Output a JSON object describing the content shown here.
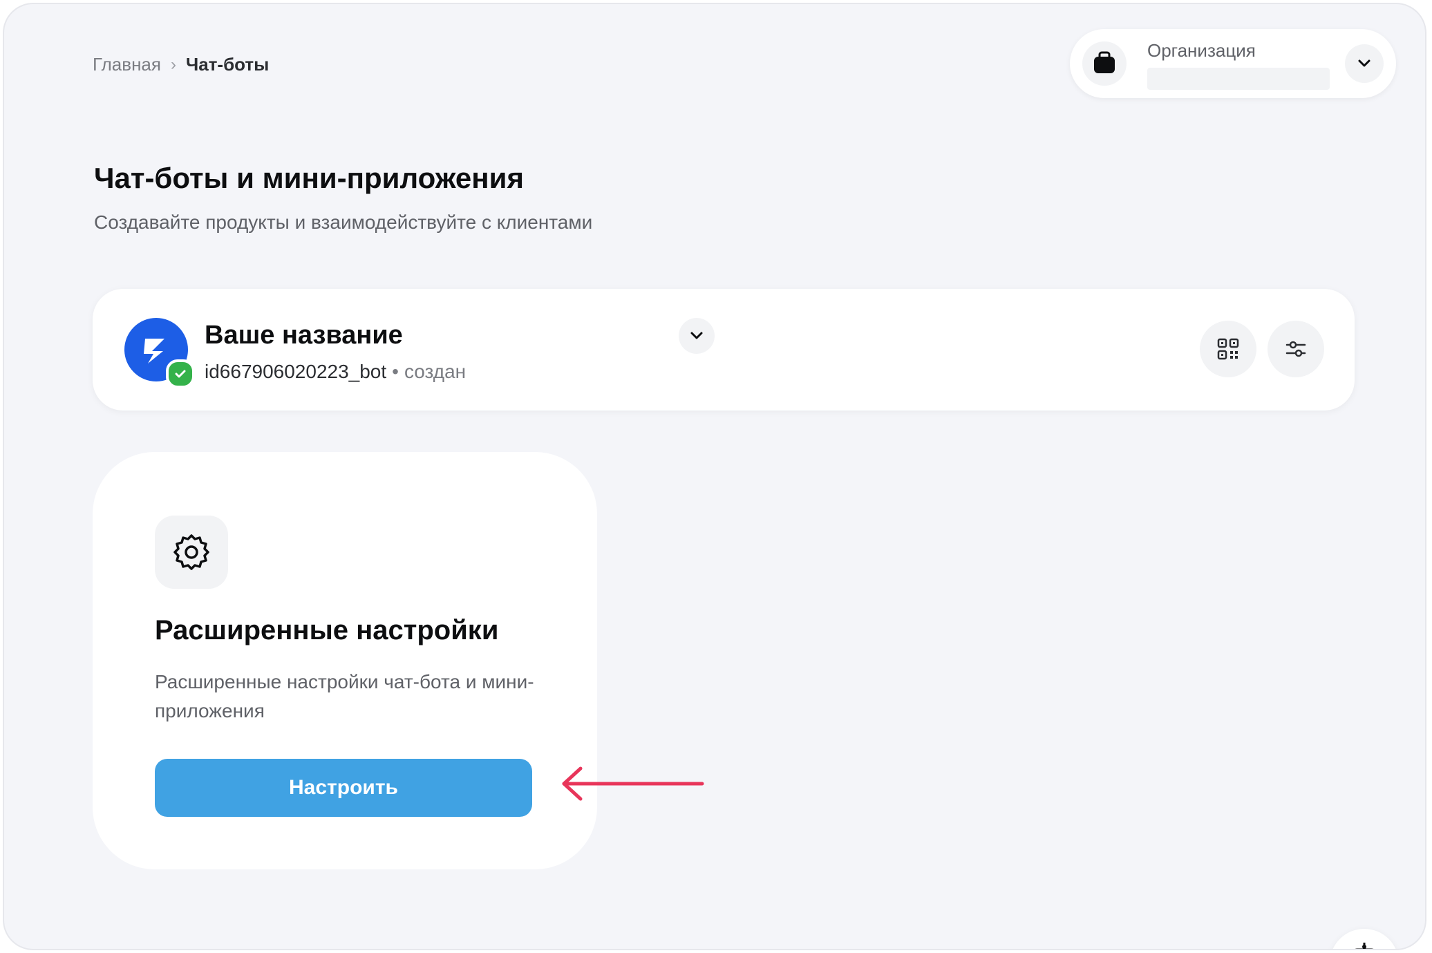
{
  "breadcrumb": {
    "home": "Главная",
    "separator": "›",
    "current": "Чат-боты"
  },
  "org_switcher": {
    "label": "Организация",
    "icon": "briefcase-icon"
  },
  "page": {
    "title": "Чат-боты и мини-приложения",
    "subtitle": "Создавайте продукты и взаимодействуйте с клиентами"
  },
  "bot": {
    "name": "Ваше название",
    "id": "id667906020223_bot",
    "separator": "•",
    "status": "создан",
    "status_color": "#34b24a",
    "avatar_color": "#1d5ee6",
    "actions": [
      "qr-code-icon",
      "sliders-icon"
    ]
  },
  "advanced_settings": {
    "icon": "gear-icon",
    "title": "Расширенные настройки",
    "description": "Расширенные настройки чат-бота и мини-приложения",
    "button_label": "Настроить",
    "button_color": "#40a2e3"
  },
  "colors": {
    "background": "#f4f5f9",
    "annotation_arrow": "#e8355a"
  }
}
